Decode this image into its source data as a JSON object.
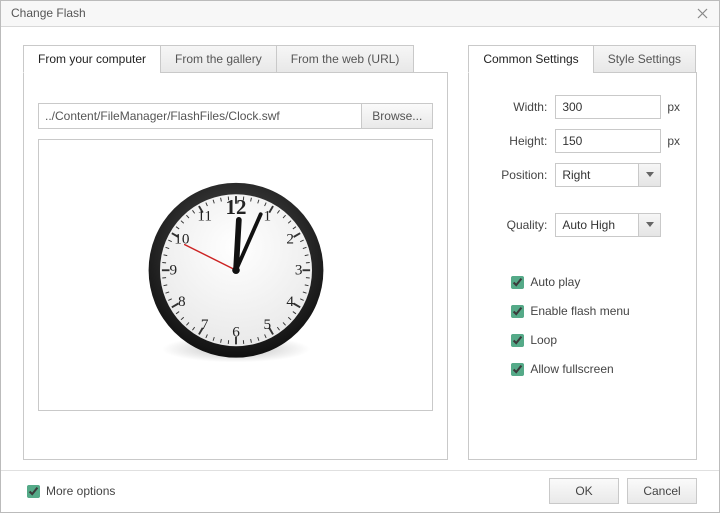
{
  "window": {
    "title": "Change Flash"
  },
  "leftTabs": {
    "items": [
      {
        "label": "From your computer"
      },
      {
        "label": "From the gallery"
      },
      {
        "label": "From the web (URL)"
      }
    ],
    "activeIndex": 0
  },
  "filePath": {
    "value": "../Content/FileManager/FlashFiles/Clock.swf",
    "browseLabel": "Browse..."
  },
  "rightTabs": {
    "items": [
      {
        "label": "Common Settings"
      },
      {
        "label": "Style Settings"
      }
    ],
    "activeIndex": 0
  },
  "settings": {
    "widthLabel": "Width:",
    "widthValue": "300",
    "widthUnit": "px",
    "heightLabel": "Height:",
    "heightValue": "150",
    "heightUnit": "px",
    "positionLabel": "Position:",
    "positionValue": "Right",
    "qualityLabel": "Quality:",
    "qualityValue": "Auto High",
    "checks": {
      "autoPlay": "Auto play",
      "enableMenu": "Enable flash menu",
      "loop": "Loop",
      "allowFullscreen": "Allow fullscreen"
    }
  },
  "footer": {
    "moreOptions": "More options",
    "ok": "OK",
    "cancel": "Cancel"
  }
}
